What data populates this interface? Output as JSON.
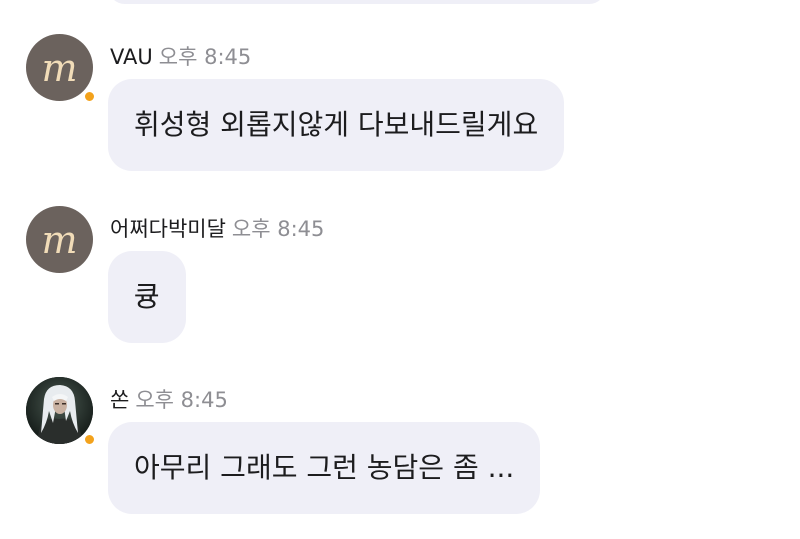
{
  "messages": [
    {
      "sender": "VAU",
      "time": "오후 8:45",
      "text": "휘성형 외롭지않게 다보내드릴게요",
      "avatar_icon": "brand-m-logo-icon",
      "avatar_letter": "m",
      "online": true
    },
    {
      "sender": "어쩌다박미달",
      "time": "오후 8:45",
      "text": "큥",
      "avatar_icon": "brand-m-logo-icon",
      "avatar_letter": "m",
      "online": false
    },
    {
      "sender": "쏜",
      "time": "오후 8:45",
      "text": "아무리 그래도 그런 농담은 좀 ...",
      "avatar_icon": "white-haired-character-portrait",
      "online": true
    }
  ],
  "colors": {
    "bubble": "#efeff7",
    "online_dot": "#f3a21c",
    "brand_avatar_bg": "#6b625d",
    "time_text": "#8e8e93"
  }
}
